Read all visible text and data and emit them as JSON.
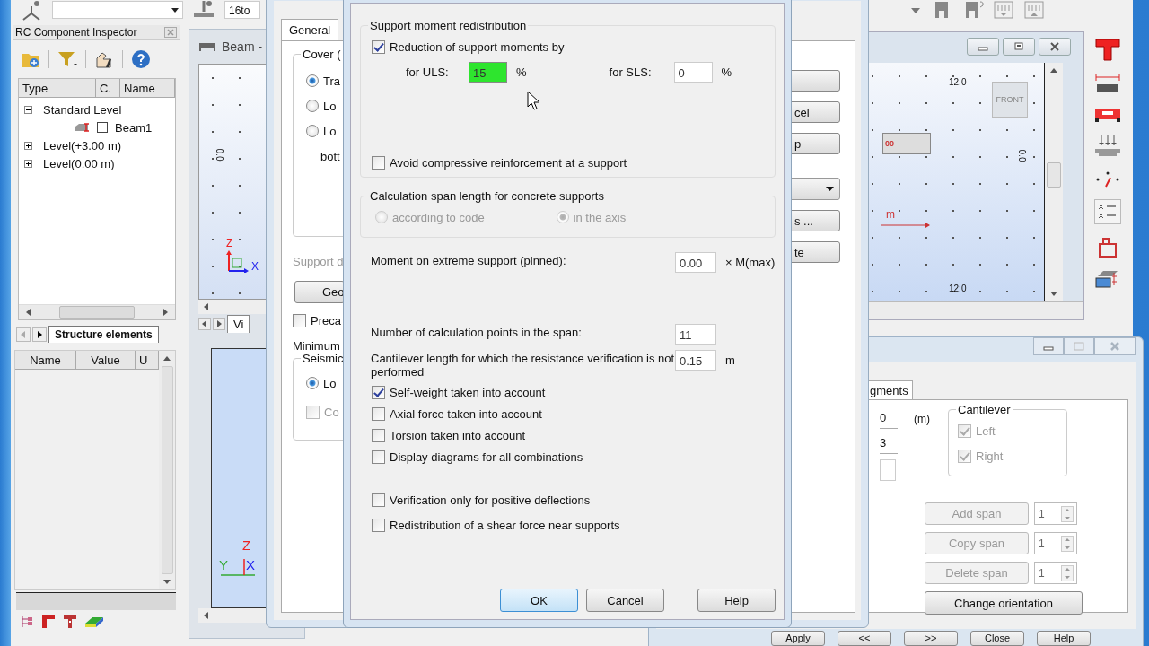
{
  "toolbar": {
    "field_text": "16to"
  },
  "inspector": {
    "title": "RC Component Inspector",
    "columns": [
      "Type",
      "C.",
      "Name"
    ],
    "tree": [
      {
        "label": "Standard Level",
        "expanded": true,
        "children": [
          {
            "label": "Beam1",
            "checked": false
          }
        ]
      },
      {
        "label": "Level(+3.00 m)",
        "expanded": false
      },
      {
        "label": "Level(0.00 m)",
        "expanded": false
      }
    ],
    "tabs": [
      {
        "label": "Structure elements",
        "selected": true
      }
    ],
    "property_columns": [
      "Name",
      "Value",
      "U"
    ]
  },
  "beam_view": {
    "title": "Beam -",
    "tick_label": "0.0",
    "axes": [
      "Z",
      "X"
    ],
    "tab": "Vi",
    "lower_axes": [
      "Z",
      "Y",
      "X"
    ]
  },
  "back_dialog": {
    "tabs": [
      {
        "label": "General",
        "selected": true
      }
    ],
    "cover_group": "Cover (",
    "cover_options": [
      {
        "label": "Tra",
        "selected": true
      },
      {
        "label": "Lo",
        "selected": false
      },
      {
        "label": "Lo",
        "selected": false
      }
    ],
    "bottom_label": "bott",
    "support_label": "Support d",
    "geometry_button": "Geo",
    "precast": {
      "label": "Preca",
      "checked": false
    },
    "minimum_label": "Minimum",
    "seismic_group": "Seismic",
    "seismic_options": [
      {
        "kind": "radio",
        "label": "Lo",
        "selected": true
      },
      {
        "kind": "checkbox",
        "label": "Co",
        "checked": false
      }
    ],
    "side_buttons": [
      {
        "kind": "button"
      },
      {
        "kind": "button",
        "label": "cel"
      },
      {
        "kind": "button",
        "label": "p"
      },
      {
        "kind": "dropdown"
      },
      {
        "kind": "button",
        "label": "s ..."
      },
      {
        "kind": "button",
        "label": "te"
      }
    ]
  },
  "front_dialog": {
    "redistribution": {
      "title": "Support moment redistribution",
      "reduction": {
        "label": "Reduction of support moments by",
        "checked": true
      },
      "uls": {
        "label": "for ULS:",
        "value": "15",
        "unit": "%",
        "highlighted": true
      },
      "sls": {
        "label": "for SLS:",
        "value": "0",
        "unit": "%",
        "highlighted": false
      },
      "avoid": {
        "label": "Avoid compressive reinforcement at a support",
        "checked": false
      }
    },
    "span_length": {
      "title": "Calculation span length for concrete supports",
      "disabled": true,
      "options": [
        {
          "label": "according to code",
          "selected": false
        },
        {
          "label": "in the axis",
          "selected": true
        }
      ]
    },
    "moment": {
      "label": "Moment on extreme support (pinned):",
      "value": "0.00",
      "unit": "× M(max)"
    },
    "points": {
      "label": "Number of calculation points in the span:",
      "value": "11"
    },
    "cantilever": {
      "label": "Cantilever length for which the resistance verification is not performed",
      "value": "0.15",
      "unit": "m"
    },
    "options": [
      {
        "label": "Self-weight taken into account",
        "checked": true
      },
      {
        "label": "Axial force taken into account",
        "checked": false
      },
      {
        "label": "Torsion taken into account",
        "checked": false
      },
      {
        "label": "Display diagrams for all combinations",
        "checked": false
      }
    ],
    "verification_options": [
      {
        "label": "Verification only for positive deflections",
        "checked": false
      },
      {
        "label": "Redistribution of a shear force near supports",
        "checked": false
      }
    ],
    "buttons": [
      {
        "label": "OK",
        "default": true
      },
      {
        "label": "Cancel",
        "default": false
      },
      {
        "label": "Help",
        "default": false
      }
    ]
  },
  "right_view": {
    "top_scale": "12.0",
    "view_cube": "FRONT",
    "beam_tag": "00",
    "side_scale": "0.0",
    "dimension": "m",
    "bottom_scale": "12:0"
  },
  "span_dialog": {
    "tab": "gments",
    "values": [
      "0",
      "3"
    ],
    "unit": "(m)",
    "cantilever": {
      "title": "Cantilever",
      "disabled": true,
      "options": [
        {
          "label": "Left",
          "checked": true
        },
        {
          "label": "Right",
          "checked": true
        }
      ]
    },
    "span_actions": [
      {
        "label": "Add span",
        "count": "1",
        "disabled": true
      },
      {
        "label": "Copy span",
        "count": "1",
        "disabled": true
      },
      {
        "label": "Delete span",
        "count": "1",
        "disabled": true
      }
    ],
    "orientation_button": "Change orientation",
    "footer_buttons": [
      "Apply",
      "<<",
      ">>",
      "Close",
      "Help"
    ]
  }
}
